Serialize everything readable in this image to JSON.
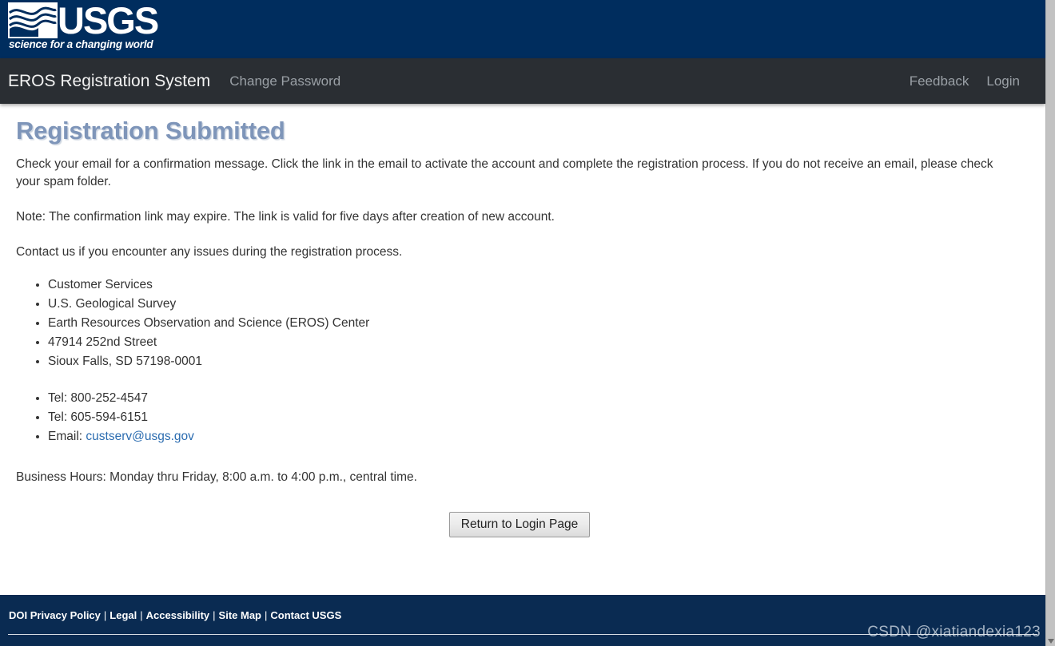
{
  "header": {
    "logo_text": "USGS",
    "logo_tagline": "science for a changing world",
    "logo_mark_name": "usgs-wave-logo"
  },
  "navbar": {
    "brand": "EROS Registration System",
    "change_password": "Change Password",
    "feedback": "Feedback",
    "login": "Login"
  },
  "main": {
    "title": "Registration Submitted",
    "paragraph_1": "Check your email for a confirmation message. Click the link in the email to activate the account and complete the registration process. If you do not receive an email, please check your spam folder.",
    "paragraph_2": "Note: The confirmation link may expire. The link is valid for five days after creation of new account.",
    "paragraph_3": "Contact us if you encounter any issues during the registration process.",
    "address_list": [
      "Customer Services",
      "U.S. Geological Survey",
      "Earth Resources Observation and Science (EROS) Center",
      "47914 252nd Street",
      "Sioux Falls, SD 57198-0001"
    ],
    "contact_list": {
      "tel_1": "Tel: 800-252-4547",
      "tel_2": "Tel: 605-594-6151",
      "email_label": "Email:",
      "email_value": "custserv@usgs.gov"
    },
    "business_hours": "Business Hours: Monday thru Friday, 8:00 a.m. to 4:00 p.m., central time.",
    "return_button": "Return to Login Page"
  },
  "footer": {
    "links": [
      "DOI Privacy Policy",
      "Legal",
      "Accessibility",
      "Site Map",
      "Contact USGS"
    ],
    "separator": "|"
  },
  "watermark": "CSDN @xiatiandexia123",
  "colors": {
    "usgs_blue": "#002d5e",
    "nav_dark": "#2a2e33",
    "footer_navy": "#0a2b52",
    "heading_blue": "#7e95b9",
    "link_blue": "#2b6cb0"
  }
}
